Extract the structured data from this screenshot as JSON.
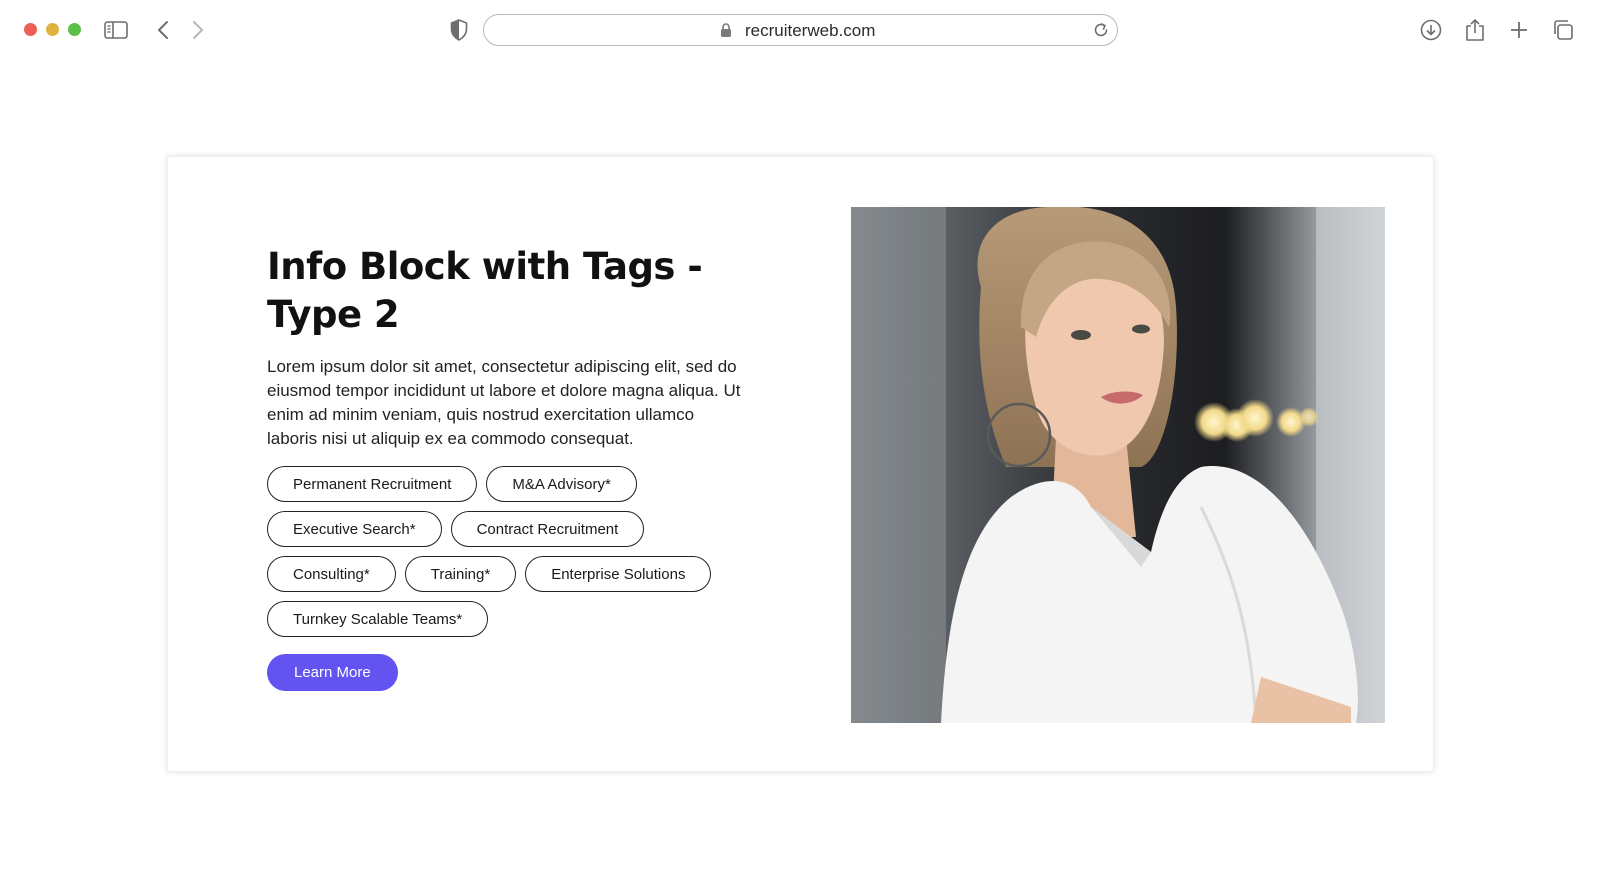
{
  "browser": {
    "url": "recruiterweb.com",
    "traffic_colors": {
      "close": "#ec5f57",
      "minimize": "#e0b240",
      "zoom": "#5cbf47"
    },
    "icons": [
      "sidebar-icon",
      "back-icon",
      "forward-icon",
      "shield-icon",
      "lock-icon",
      "reload-icon",
      "download-icon",
      "share-icon",
      "new-tab-icon",
      "tabs-overview-icon"
    ]
  },
  "info_block": {
    "title": "Info Block with Tags - Type 2",
    "description": "Lorem ipsum dolor sit amet, consectetur adipiscing elit, sed do eiusmod tempor incididunt ut labore et dolore magna aliqua. Ut enim ad minim veniam, quis nostrud exercitation ullamco laboris nisi ut aliquip ex ea commodo consequat.",
    "tags": [
      "Permanent Recruitment",
      "M&A Advisory*",
      "Executive Search*",
      "Contract Recruitment",
      "Consulting*",
      "Training*",
      "Enterprise Solutions",
      "Turnkey Scalable Teams*"
    ],
    "cta_label": "Learn More",
    "accent_color": "#6353f0"
  }
}
